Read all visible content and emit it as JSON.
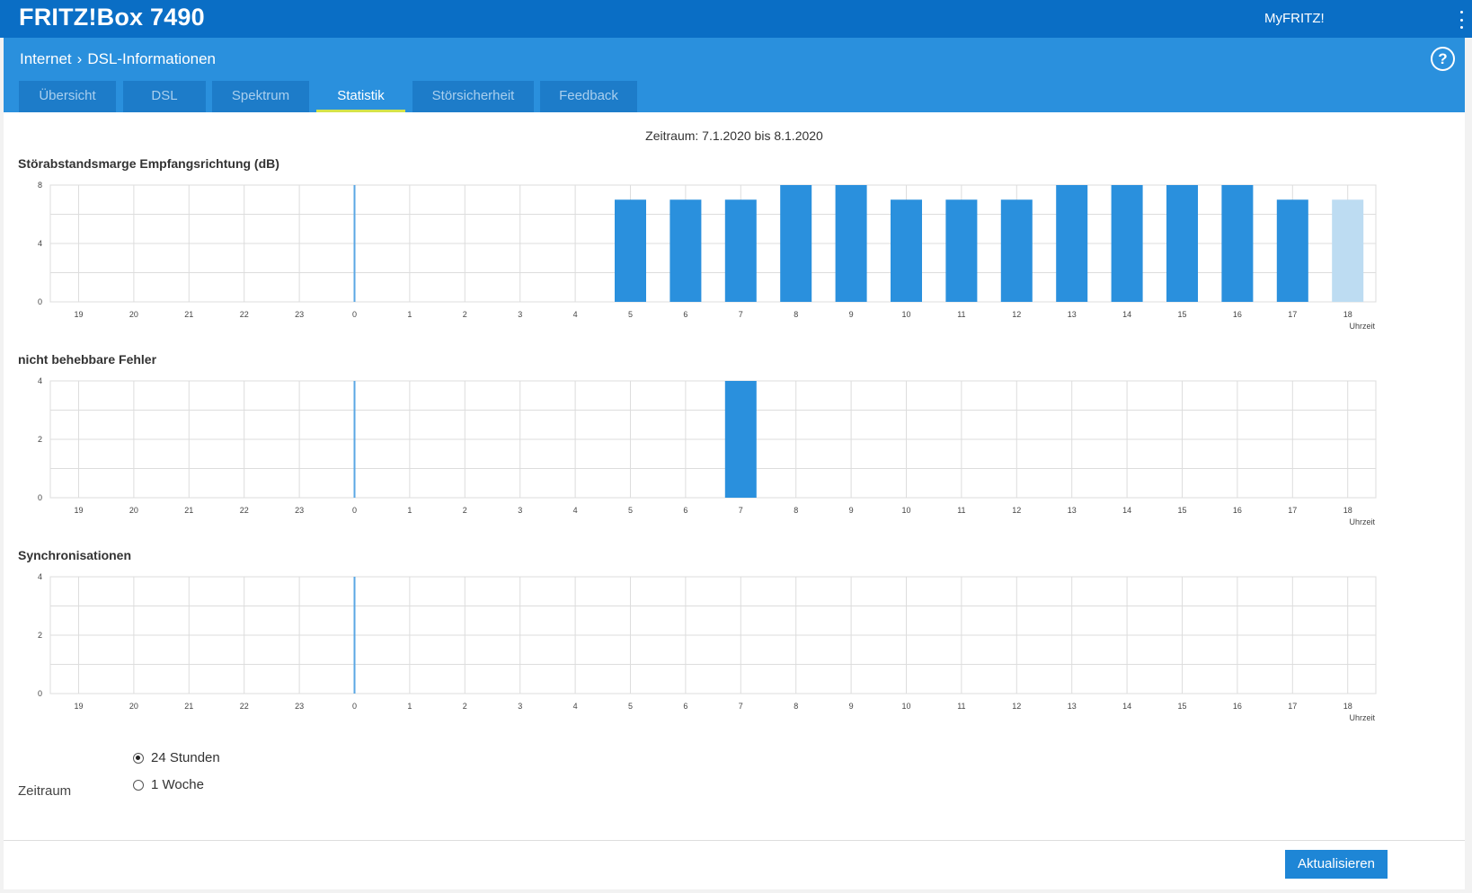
{
  "header": {
    "brand": "FRITZ!Box 7490",
    "myfritz": "MyFRITZ!",
    "menu_icon": "kebab-menu-icon"
  },
  "breadcrumb": {
    "items": [
      "Internet",
      "DSL-Informationen"
    ],
    "separator_icon": "chevron-right-icon"
  },
  "help": {
    "icon": "help-icon",
    "label": "?"
  },
  "tabs": [
    {
      "label": "Übersicht",
      "active": false
    },
    {
      "label": "DSL",
      "active": false
    },
    {
      "label": "Spektrum",
      "active": false
    },
    {
      "label": "Statistik",
      "active": true
    },
    {
      "label": "Störsicherheit",
      "active": false
    },
    {
      "label": "Feedback",
      "active": false
    }
  ],
  "period_text": "Zeitraum: 7.1.2020 bis 8.1.2020",
  "colors": {
    "bar": "#2a90dd",
    "bar_current": "#bddcf2",
    "marker": "#5aa7e4",
    "grid": "#dddddd",
    "topbar": "#0a6ec5",
    "subheader": "#2a90dd",
    "active_tab_underline": "#d5e34a"
  },
  "chart_data": [
    {
      "type": "bar",
      "title": "Störabstandsmarge Empfangsrichtung (dB)",
      "categories": [
        "19",
        "20",
        "21",
        "22",
        "23",
        "0",
        "1",
        "2",
        "3",
        "4",
        "5",
        "6",
        "7",
        "8",
        "9",
        "10",
        "11",
        "12",
        "13",
        "14",
        "15",
        "16",
        "17",
        "18"
      ],
      "values": [
        0,
        0,
        0,
        0,
        0,
        0,
        0,
        0,
        0,
        0,
        7,
        7,
        7,
        8,
        8,
        7,
        7,
        7,
        8,
        8,
        8,
        8,
        7,
        7
      ],
      "ylim": [
        0,
        8
      ],
      "yticks": [
        "0",
        "4",
        "8"
      ],
      "xlabel": "Uhrzeit",
      "day_boundary": "0",
      "current_category": "18",
      "grid": true
    },
    {
      "type": "bar",
      "title": "nicht behebbare Fehler",
      "categories": [
        "19",
        "20",
        "21",
        "22",
        "23",
        "0",
        "1",
        "2",
        "3",
        "4",
        "5",
        "6",
        "7",
        "8",
        "9",
        "10",
        "11",
        "12",
        "13",
        "14",
        "15",
        "16",
        "17",
        "18"
      ],
      "values": [
        0,
        0,
        0,
        0,
        0,
        0,
        0,
        0,
        0,
        0,
        0,
        0,
        4,
        0,
        0,
        0,
        0,
        0,
        0,
        0,
        0,
        0,
        0,
        0
      ],
      "ylim": [
        0,
        4
      ],
      "yticks": [
        "0",
        "2",
        "4"
      ],
      "xlabel": "Uhrzeit",
      "day_boundary": "0",
      "current_category": "",
      "grid": true
    },
    {
      "type": "bar",
      "title": "Synchronisationen",
      "categories": [
        "19",
        "20",
        "21",
        "22",
        "23",
        "0",
        "1",
        "2",
        "3",
        "4",
        "5",
        "6",
        "7",
        "8",
        "9",
        "10",
        "11",
        "12",
        "13",
        "14",
        "15",
        "16",
        "17",
        "18"
      ],
      "values": [
        0,
        0,
        0,
        0,
        0,
        0,
        0,
        0,
        0,
        0,
        0,
        0,
        0,
        0,
        0,
        0,
        0,
        0,
        0,
        0,
        0,
        0,
        0,
        0
      ],
      "ylim": [
        0,
        4
      ],
      "yticks": [
        "0",
        "2",
        "4"
      ],
      "xlabel": "Uhrzeit",
      "day_boundary": "0",
      "current_category": "",
      "grid": true
    }
  ],
  "zeitraum": {
    "label": "Zeitraum",
    "options": [
      {
        "label": "24 Stunden",
        "checked": true
      },
      {
        "label": "1 Woche",
        "checked": false
      }
    ]
  },
  "refresh_button": "Aktualisieren"
}
